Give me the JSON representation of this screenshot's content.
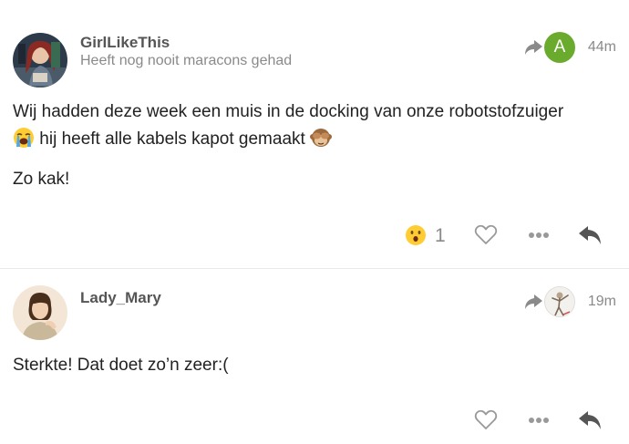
{
  "posts": [
    {
      "username": "GirlLikeThis",
      "user_title": "Heeft nog nooit maracons gehad",
      "reply_to_initial": "A",
      "reply_to_color": "#6aab2e",
      "date": "44m",
      "body": {
        "line1": "Wij hadden deze week een muis in de docking van onze robotstofzuiger",
        "line2_emoji_before": "loudly-crying-face",
        "line2": " hij heeft alle kabels kapot gemaakt ",
        "line2_emoji_after": "see-no-evil-monkey",
        "paragraph2": "Zo kak!"
      },
      "reactions": {
        "emoji": "hushed-face",
        "count": "1"
      }
    },
    {
      "username": "Lady_Mary",
      "user_title": "",
      "date": "19m",
      "body": {
        "paragraph1": "Sterkte! Dat doet zo’n zeer:("
      }
    }
  ],
  "colors": {
    "text": "#222222",
    "meta": "#8a8a8a",
    "username": "#555555",
    "icon": "#999999",
    "reply_icon": "#555555",
    "divider": "#e9e9e9"
  }
}
